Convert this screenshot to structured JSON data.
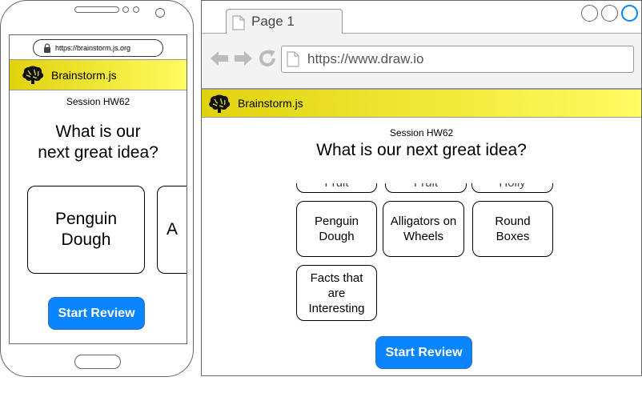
{
  "phone": {
    "url": "https://brainstorm.js.org",
    "app_title": "Brainstorm.js",
    "session": "Session HW62",
    "question_line1": "What is our",
    "question_line2": "next great idea?",
    "cards": [
      {
        "line1": "Penguin",
        "line2": "Dough"
      },
      {
        "partial": "A"
      }
    ],
    "start_button": "Start Review"
  },
  "browser": {
    "tab_title": "Page 1",
    "url": "https://www.draw.io",
    "app_title": "Brainstorm.js",
    "session": "Session HW62",
    "question": "What is our next great idea?",
    "partial_cards": [
      "Fruit",
      "Fruit",
      "Holly"
    ],
    "cards": [
      {
        "lines": [
          "Penguin",
          "Dough"
        ]
      },
      {
        "lines": [
          "Alligators on",
          "Wheels"
        ]
      },
      {
        "lines": [
          "Round",
          "Boxes"
        ]
      },
      {
        "lines": [
          "Facts that",
          "are",
          "Interesting"
        ]
      }
    ],
    "start_button": "Start Review"
  },
  "colors": {
    "accent": "#0a84ff",
    "banner_start": "#e1d20e",
    "banner_end": "#fffb63"
  },
  "icons": [
    "lock-icon",
    "brain-icon",
    "page-icon",
    "back-arrow-icon",
    "forward-arrow-icon",
    "reload-icon"
  ]
}
